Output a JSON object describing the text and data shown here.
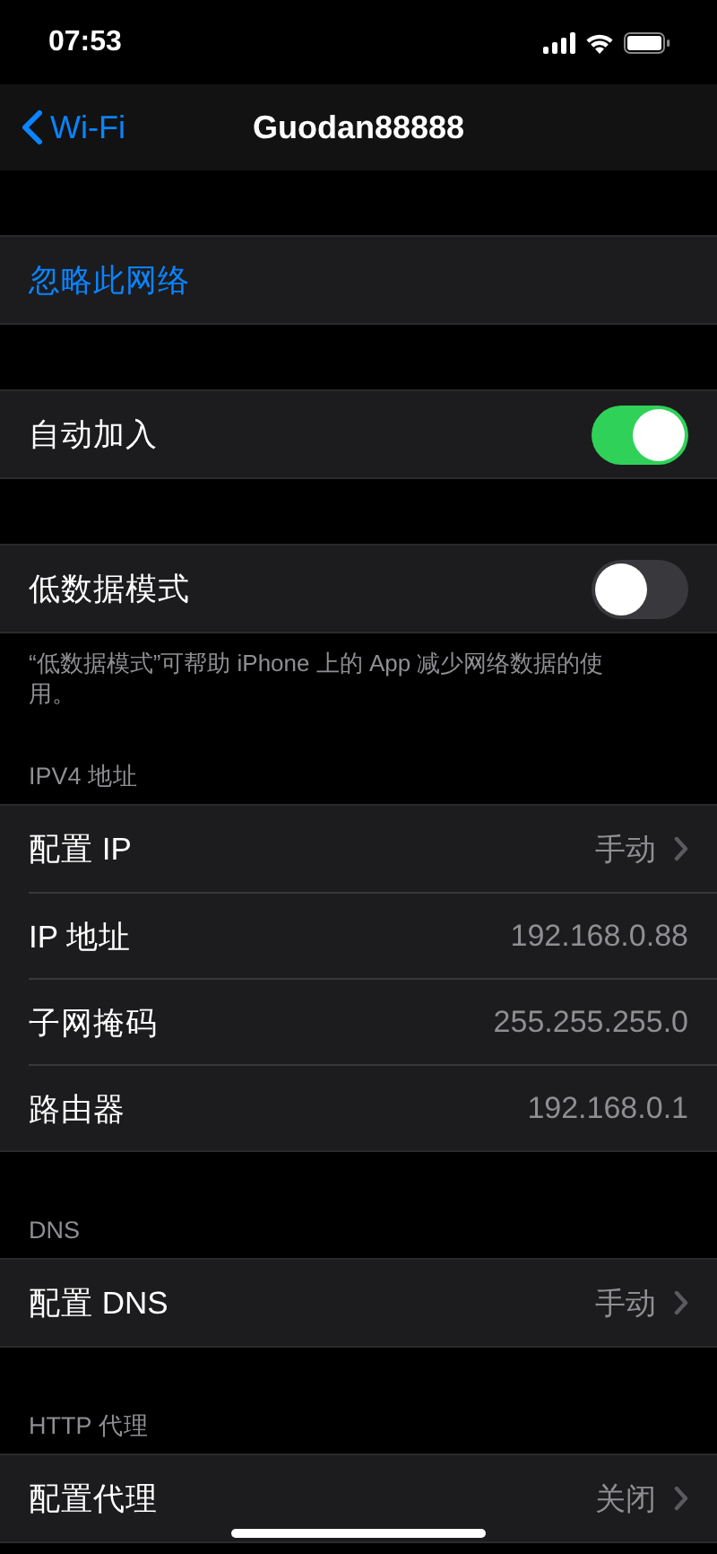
{
  "status_bar": {
    "time": "07:53"
  },
  "nav": {
    "back": "Wi-Fi",
    "title": "Guodan88888"
  },
  "sections": [
    {
      "rows": [
        {
          "kind": "action",
          "label": "忽略此网络"
        }
      ]
    },
    {
      "rows": [
        {
          "kind": "toggle",
          "label": "自动加入",
          "on": true
        }
      ]
    },
    {
      "rows": [
        {
          "kind": "toggle",
          "label": "低数据模式",
          "on": false
        }
      ],
      "footer": "“低数据模式”可帮助 iPhone 上的 App 减少网络数据的使用。"
    },
    {
      "header": "IPV4 地址",
      "rows": [
        {
          "kind": "link",
          "label": "配置 IP",
          "value": "手动"
        },
        {
          "kind": "value",
          "label": "IP 地址",
          "value": "192.168.0.88"
        },
        {
          "kind": "value",
          "label": "子网掩码",
          "value": "255.255.255.0"
        },
        {
          "kind": "value",
          "label": "路由器",
          "value": "192.168.0.1"
        }
      ]
    },
    {
      "header": "DNS",
      "rows": [
        {
          "kind": "link",
          "label": "配置 DNS",
          "value": "手动"
        }
      ]
    },
    {
      "header": "HTTP 代理",
      "rows": [
        {
          "kind": "link",
          "label": "配置代理",
          "value": "关闭"
        }
      ]
    }
  ]
}
